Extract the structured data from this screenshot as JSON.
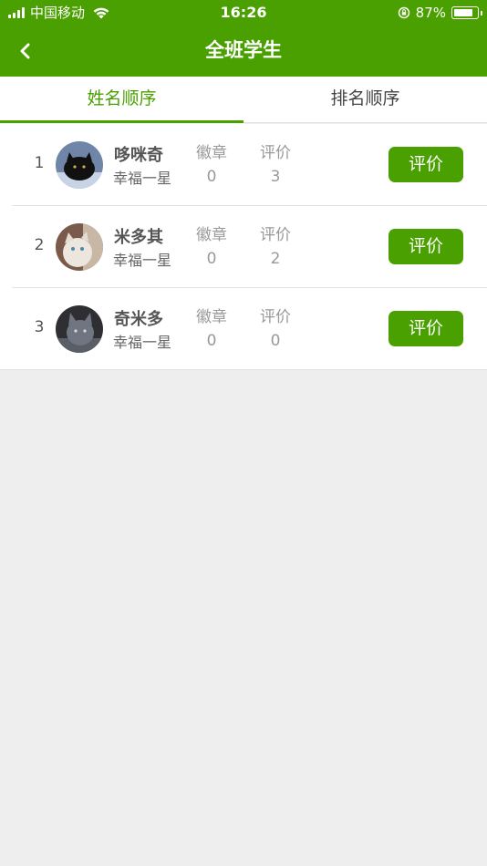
{
  "status_bar": {
    "carrier": "中国移动",
    "time": "16:26",
    "battery_percent": "87%",
    "battery_level": 0.87
  },
  "header": {
    "title": "全班学生",
    "back_icon": "chevron-left-icon"
  },
  "tabs": [
    {
      "label": "姓名顺序",
      "active": true
    },
    {
      "label": "排名顺序",
      "active": false
    }
  ],
  "columns": {
    "badges_label": "徽章",
    "evaluations_label": "评价"
  },
  "students": [
    {
      "index": "1",
      "name": "哆咪奇",
      "level": "幸福一星",
      "badges": "0",
      "evaluations": "3",
      "button_label": "评价"
    },
    {
      "index": "2",
      "name": "米多其",
      "level": "幸福一星",
      "badges": "0",
      "evaluations": "2",
      "button_label": "评价"
    },
    {
      "index": "3",
      "name": "奇米多",
      "level": "幸福一星",
      "badges": "0",
      "evaluations": "0",
      "button_label": "评价"
    }
  ],
  "colors": {
    "brand_green": "#4aa000",
    "background": "#eeeeee"
  }
}
